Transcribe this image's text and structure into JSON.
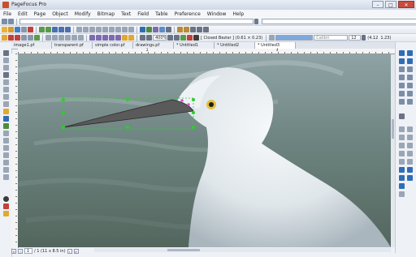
{
  "window": {
    "title": "PageFocus Pro",
    "controls": {
      "minimize": "–",
      "maximize": "□",
      "close": "✕"
    }
  },
  "menu": [
    "File",
    "Edit",
    "Page",
    "Object",
    "Modify",
    "Bitmap",
    "Text",
    "Field",
    "Table",
    "Preference",
    "Window",
    "Help"
  ],
  "toolbar": {
    "zoom": "400%",
    "object_type": "[ Closed Bezier ] (0.61 × 0.23)",
    "font": "Calibri",
    "font_size": "12",
    "pos_x": "(4.12",
    "pos_y": "1.23)"
  },
  "tabs": [
    {
      "label": "image1.pf",
      "active": false
    },
    {
      "label": "transparent.pf",
      "active": false
    },
    {
      "label": "simple color.pf",
      "active": false
    },
    {
      "label": "drawings.pf",
      "active": false
    },
    {
      "label": "* Untitled1",
      "active": false
    },
    {
      "label": "* Untitled2",
      "active": false
    },
    {
      "label": "* Untitled3",
      "active": true
    }
  ],
  "ruler": {
    "mark_2": "2",
    "mark_4": "4"
  },
  "status": {
    "page_number": "1",
    "page_info": "/ 1 (11 x 8.5 in)"
  },
  "colors": {
    "accent": "#2f6db5",
    "selection_handle": "#2ecc2e",
    "beak_fill": "#5a5a5a"
  }
}
